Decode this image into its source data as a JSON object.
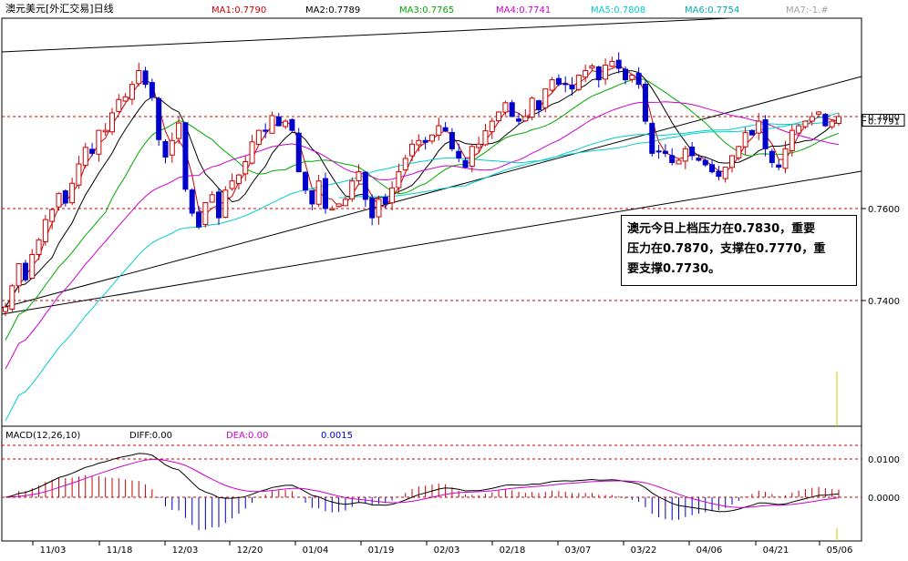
{
  "header": {
    "title": "澳元美元[外汇交易]日线",
    "indicators": [
      {
        "label": "MA1:0.7790",
        "color": "#cc0000"
      },
      {
        "label": "MA2:0.7789",
        "color": "#000000"
      },
      {
        "label": "MA3:0.7765",
        "color": "#00aa00"
      },
      {
        "label": "MA4:0.7741",
        "color": "#cc00cc"
      },
      {
        "label": "MA5:0.7808",
        "color": "#00cccc"
      },
      {
        "label": "MA6:0.7754",
        "color": "#00aaaa"
      },
      {
        "label": "MA7:-1.#",
        "color": "#a0a0a0"
      }
    ]
  },
  "macd_header": {
    "name": "MACD(12,26,10)",
    "diff": "DIFF:0.00",
    "dea": "DEA:0.00",
    "value": "0.0015"
  },
  "annotation": {
    "lines": [
      "澳元今日上档压力在0.7830，重要",
      "压力在0.7870，支撑在0.7770，重",
      "要支撑0.7730。"
    ]
  },
  "colors": {
    "up": "#cc0000",
    "down": "#0000cc",
    "grid": "#cc0000",
    "ma1": "#cc0000",
    "ma2": "#000000",
    "ma3": "#00aa00",
    "ma4": "#cc00cc",
    "ma5": "#00cccc"
  },
  "chart_data": [
    {
      "type": "candlestick",
      "title": "澳元美元[外汇交易]日线",
      "y_ticks": [
        "0.7791",
        "0.7800",
        "0.7600",
        "0.7400"
      ],
      "y_tick_values": [
        0.7791,
        0.78,
        0.76,
        0.74
      ],
      "ylim": [
        0.73,
        0.8
      ],
      "x_ticks": [
        "11/03",
        "11/18",
        "12/03",
        "12/20",
        "01/04",
        "01/19",
        "02/03",
        "02/18",
        "03/07",
        "03/22",
        "04/06",
        "04/21",
        "05/06"
      ],
      "grid_levels": [
        0.78,
        0.76,
        0.74
      ],
      "closes": [
        0.7386,
        0.7432,
        0.748,
        0.7445,
        0.75,
        0.7532,
        0.7576,
        0.7598,
        0.7633,
        0.7612,
        0.7655,
        0.7697,
        0.7733,
        0.772,
        0.777,
        0.777,
        0.7808,
        0.7837,
        0.7843,
        0.787,
        0.79,
        0.787,
        0.7842,
        0.775,
        0.7712,
        0.7748,
        0.7786,
        0.7642,
        0.759,
        0.756,
        0.7613,
        0.763,
        0.758,
        0.764,
        0.766,
        0.7673,
        0.7702,
        0.7745,
        0.777,
        0.7768,
        0.7802,
        0.778,
        0.779,
        0.777,
        0.768,
        0.764,
        0.761,
        0.766,
        0.76,
        0.76,
        0.761,
        0.762,
        0.766,
        0.768,
        0.762,
        0.758,
        0.762,
        0.761,
        0.7645,
        0.768,
        0.7709,
        0.774,
        0.7748,
        0.7744,
        0.776,
        0.778,
        0.7769,
        0.773,
        0.771,
        0.769,
        0.7735,
        0.774,
        0.7769,
        0.779,
        0.781,
        0.783,
        0.78,
        0.779,
        0.78,
        0.784,
        0.7815,
        0.786,
        0.788,
        0.787,
        0.787,
        0.786,
        0.789,
        0.79,
        0.791,
        0.788,
        0.7912,
        0.792,
        0.7905,
        0.788,
        0.789,
        0.787,
        0.779,
        0.772,
        0.7725,
        0.772,
        0.77,
        0.7705,
        0.773,
        0.7715,
        0.7705,
        0.7695,
        0.768,
        0.767,
        0.769,
        0.7715,
        0.7735,
        0.7765,
        0.776,
        0.779,
        0.773,
        0.77,
        0.769,
        0.773,
        0.777,
        0.778,
        0.779,
        0.78,
        0.781,
        0.778,
        0.779,
        0.78
      ],
      "series": [
        {
          "name": "MA1:0.7790"
        },
        {
          "name": "MA2:0.7789"
        },
        {
          "name": "MA3:0.7765"
        },
        {
          "name": "MA4:0.7741"
        },
        {
          "name": "MA5:0.7808"
        },
        {
          "name": "MA6:0.7754"
        },
        {
          "name": "MA7:-1.#"
        }
      ]
    },
    {
      "type": "bar",
      "title": "MACD(12,26,10)",
      "y_ticks": [
        "0.0100",
        "0.0000"
      ],
      "y_tick_values": [
        0.01,
        0.0
      ],
      "ylim": [
        -0.011,
        0.02
      ],
      "series": [
        {
          "name": "DIFF:0.00"
        },
        {
          "name": "DEA:0.00"
        }
      ]
    }
  ]
}
